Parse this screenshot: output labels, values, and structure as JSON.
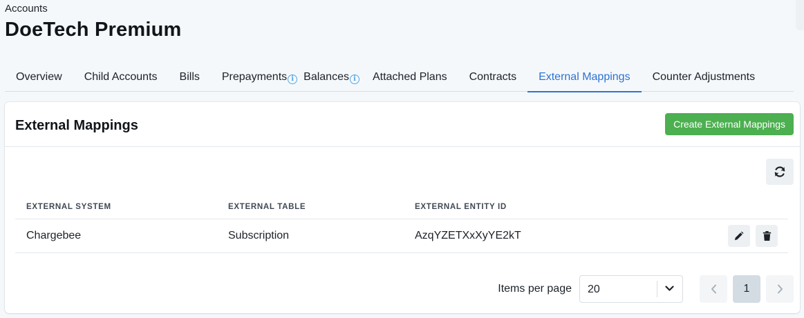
{
  "breadcrumb": "Accounts",
  "page_title": "DoeTech Premium",
  "tabs": [
    {
      "label": "Overview"
    },
    {
      "label": "Child Accounts"
    },
    {
      "label": "Bills"
    },
    {
      "label": "Prepayments",
      "info_icon": "info-icon"
    },
    {
      "label": "Balances",
      "info_icon": "info-icon"
    },
    {
      "label": "Attached Plans"
    },
    {
      "label": "Contracts"
    },
    {
      "label": "External Mappings",
      "active": true
    },
    {
      "label": "Counter Adjustments"
    }
  ],
  "card": {
    "title": "External Mappings",
    "create_button": "Create External Mappings",
    "refresh_icon": "refresh-icon"
  },
  "table": {
    "headers": [
      "EXTERNAL SYSTEM",
      "EXTERNAL TABLE",
      "EXTERNAL ENTITY ID"
    ],
    "rows": [
      {
        "system": "Chargebee",
        "table": "Subscription",
        "entity_id": "AzqYZETXxXyYE2kT",
        "actions": [
          "edit-icon",
          "trash-icon"
        ]
      }
    ]
  },
  "pagination": {
    "items_per_page_label": "Items per page",
    "items_per_page": "20",
    "current_page": "1"
  },
  "colors": {
    "accent": "#2d72d2",
    "create_button": "#4caf50",
    "info_icon": "#52a6e6"
  }
}
